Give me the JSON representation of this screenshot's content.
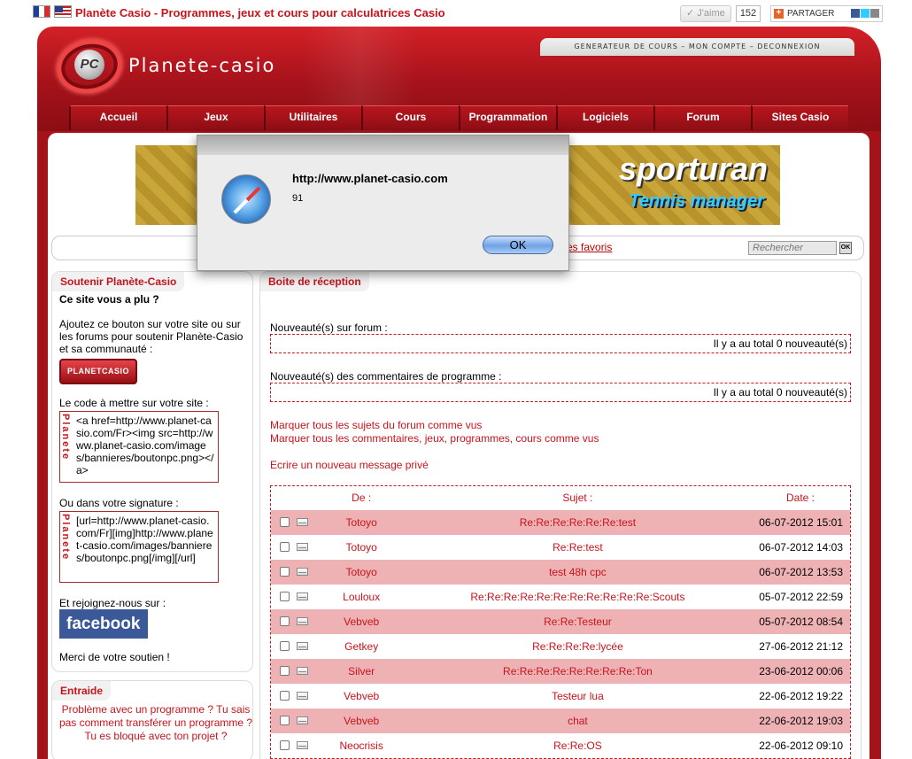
{
  "topbar": {
    "site_title": "Planète Casio - Programmes, jeux et cours pour calculatrices Casio",
    "like_label": "J'aime",
    "like_count": "152",
    "share_label": "PARTAGER"
  },
  "header": {
    "logo_text": "Planete-casio",
    "logo_mark": "PC",
    "top_links": "GENERATEUR DE COURS  –  MON COMPTE  –  DECONNEXION",
    "nav": [
      "Accueil",
      "Jeux",
      "Utilitaires",
      "Cours",
      "Programmation",
      "Logiciels",
      "Forum",
      "Sites Casio"
    ]
  },
  "banner": {
    "line1": "sporturan",
    "line2": "Tennis manager"
  },
  "search": {
    "fav_link": "es favoris",
    "placeholder": "Rechercher",
    "ok_label": "OK"
  },
  "sidebar": {
    "support_title": "Soutenir Planète-Casio",
    "support_heading": "Ce site vous a plu ?",
    "support_text": "Ajoutez ce bouton sur votre site ou sur les forums pour soutenir Planète-Casio et sa communauté :",
    "button_label": "PLANETCASIO",
    "code_label": "Le code à mettre sur votre site :",
    "code_html": "<a href=http://www.planet-casio.com/Fr><img src=http://www.planet-casio.com/images/bannieres/boutonpc.png></a>",
    "code_vertical": "Planete",
    "signature_label": "Ou dans votre signature :",
    "code_bbcode": "[url=http://www.planet-casio.com/Fr][img]http://www.planet-casio.com/images/bannieres/boutonpc.png[/img][/url]",
    "join_label": "Et rejoignez-nous sur :",
    "facebook_label": "facebook",
    "thanks": "Merci de votre soutien !",
    "entraide_title": "Entraide",
    "entraide_text": "Problème avec un programme ? Tu sais pas comment transférer un programme ? Tu es bloqué avec ton projet ?"
  },
  "main": {
    "title": "Boite de réception",
    "forum_label": "Nouveauté(s) sur forum :",
    "forum_count": "Il y a au total 0 nouveauté(s)",
    "comments_label": "Nouveauté(s) des commentaires de programme :",
    "comments_count": "Il y a au total 0 nouveauté(s)",
    "mark_forum": "Marquer tous les sujets du forum comme vus",
    "mark_comments": "Marquer tous les commentaires, jeux, programmes, cours comme vus",
    "new_message": "Ecrire un nouveau message privé",
    "table_headers": {
      "from": "De :",
      "subject": "Sujet :",
      "date": "Date :"
    },
    "messages": [
      {
        "from": "Totoyo",
        "subject": "Re:Re:Re:Re:Re:Re:test",
        "date": "06-07-2012 15:01"
      },
      {
        "from": "Totoyo",
        "subject": "Re:Re:test",
        "date": "06-07-2012 14:03"
      },
      {
        "from": "Totoyo",
        "subject": "test 48h cpc",
        "date": "06-07-2012 13:53"
      },
      {
        "from": "Louloux",
        "subject": "Re:Re:Re:Re:Re:Re:Re:Re:Re:Re:Re:Scouts",
        "date": "05-07-2012 22:59"
      },
      {
        "from": "Vebveb",
        "subject": "Re:Re:Testeur",
        "date": "05-07-2012 08:54"
      },
      {
        "from": "Getkey",
        "subject": "Re:Re:Re:Re:lycée",
        "date": "27-06-2012 21:12"
      },
      {
        "from": "Silver",
        "subject": "Re:Re:Re:Re:Re:Re:Re:Re:Ton",
        "date": "23-06-2012 00:06"
      },
      {
        "from": "Vebveb",
        "subject": "Testeur lua",
        "date": "22-06-2012 19:22"
      },
      {
        "from": "Vebveb",
        "subject": "chat",
        "date": "22-06-2012 19:03"
      },
      {
        "from": "Neocrisis",
        "subject": "Re:Re:OS",
        "date": "22-06-2012 09:10"
      }
    ]
  },
  "dialog": {
    "url": "http://www.planet-casio.com",
    "message": "91",
    "ok_label": "OK"
  }
}
